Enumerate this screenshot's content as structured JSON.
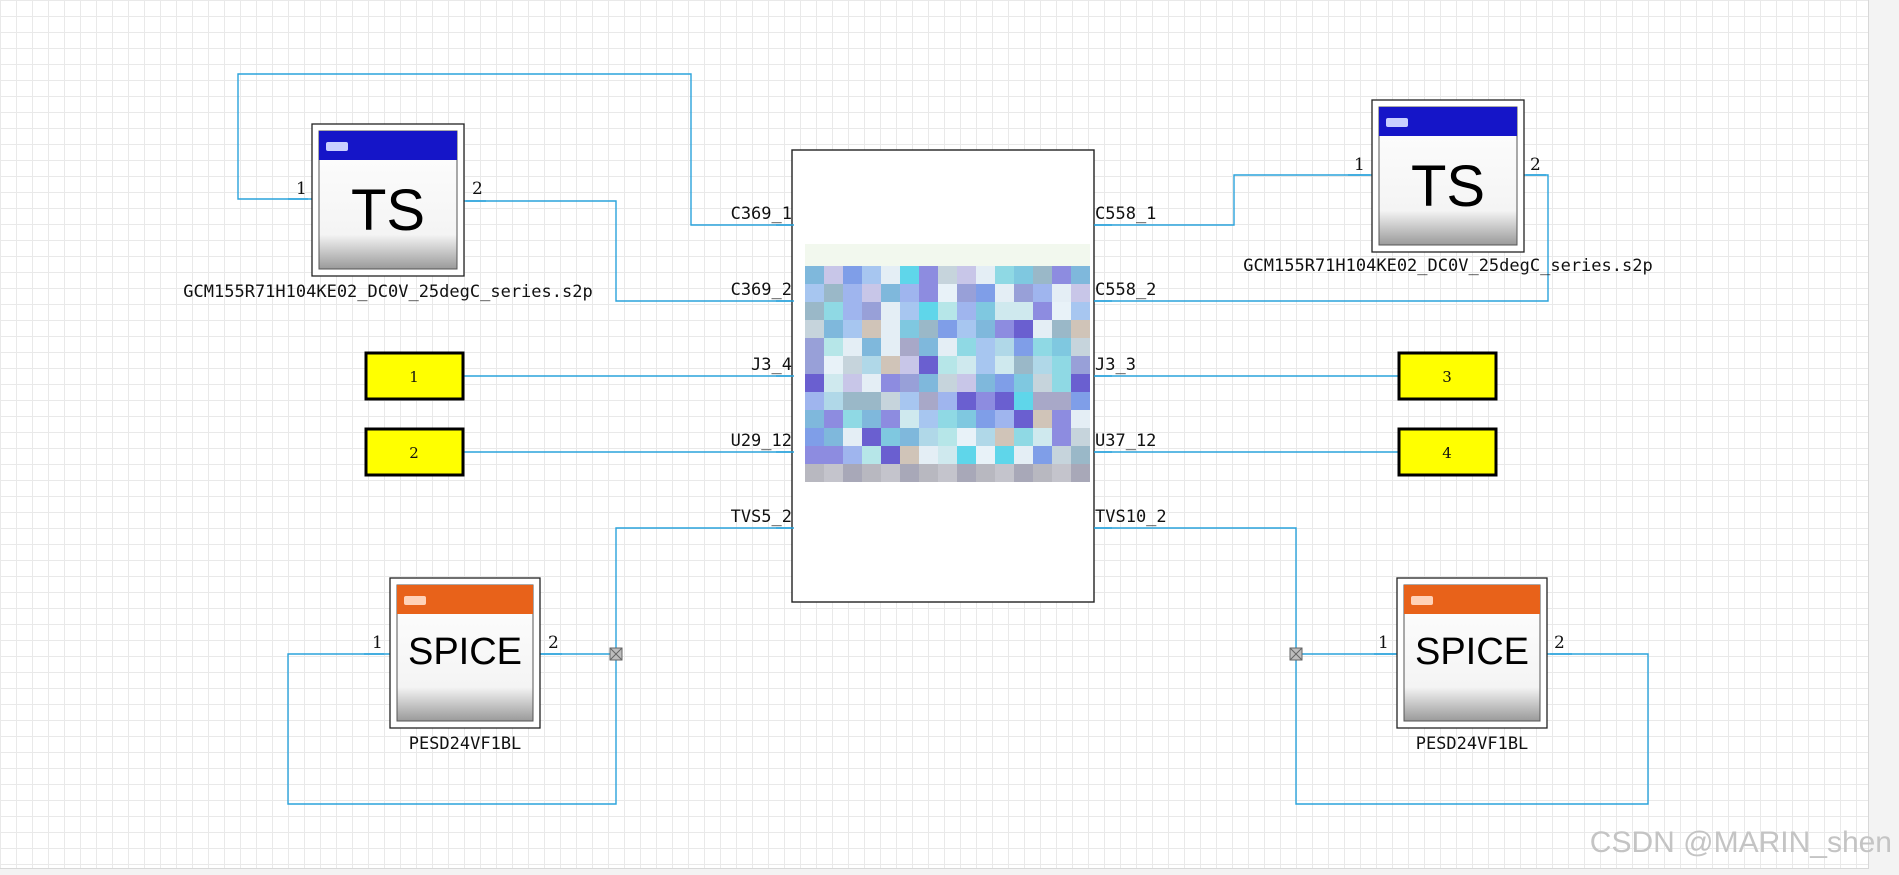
{
  "colors": {
    "wire": "#2aa3dc",
    "ts_header": "#1515c8",
    "spice_header": "#e8621a",
    "port_fill": "#ffff00",
    "grid": "#e9e9e9"
  },
  "components": {
    "ts_left": {
      "glyph": "TS",
      "name": "GCM155R71H104KE02_DC0V_25degC_series.s2p",
      "pin1": "1",
      "pin2": "2"
    },
    "ts_right": {
      "glyph": "TS",
      "name": "GCM155R71H104KE02_DC0V_25degC_series.s2p",
      "pin1": "1",
      "pin2": "2"
    },
    "spice_left": {
      "glyph": "SPICE",
      "name": "PESD24VF1BL",
      "pin1": "1",
      "pin2": "2"
    },
    "spice_right": {
      "glyph": "SPICE",
      "name": "PESD24VF1BL",
      "pin1": "1",
      "pin2": "2"
    }
  },
  "board": {
    "left_pins": [
      "C369_1",
      "C369_2",
      "J3_4",
      "U29_12",
      "TVS5_2"
    ],
    "right_pins": [
      "C558_1",
      "C558_2",
      "J3_3",
      "U37_12",
      "TVS10_2"
    ]
  },
  "ports": {
    "p1": "1",
    "p2": "2",
    "p3": "3",
    "p4": "4"
  },
  "watermark": "CSDN @MARIN_shen"
}
